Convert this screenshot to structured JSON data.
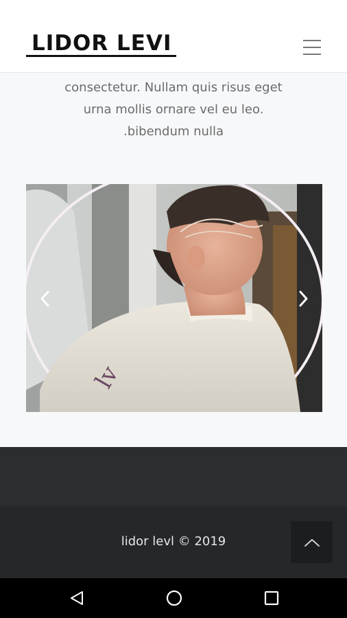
{
  "header": {
    "logo_text": "LIDOR LEVI",
    "menu_icon": "hamburger-menu-icon"
  },
  "intro": {
    "lines": [
      "consectetur. Nullam quis risus eget",
      "urna mollis ornare vel eu leo.",
      ".bibendum nulla"
    ]
  },
  "carousel": {
    "prev_icon": "chevron-left-icon",
    "next_icon": "chevron-right-icon"
  },
  "footer": {
    "copyright": "lidor levl © 2019",
    "back_to_top_icon": "chevron-up-icon"
  },
  "android_nav": {
    "back_icon": "back-triangle-icon",
    "home_icon": "home-circle-icon",
    "recents_icon": "recents-square-icon"
  },
  "colors": {
    "header_bg": "#ffffff",
    "page_bg": "#f7f8fa",
    "text_muted": "#6b6b6b",
    "footer_dark": "#25272b",
    "band_dark": "#2b2d31",
    "back_to_top_bg": "#1c1d1f",
    "nav_bar": "#000000"
  }
}
